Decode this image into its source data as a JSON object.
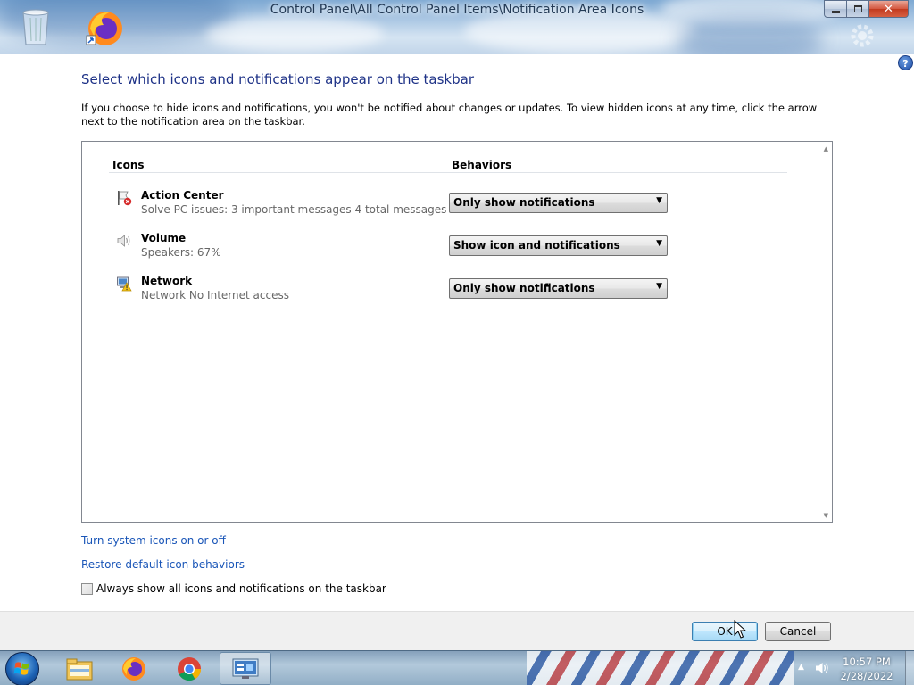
{
  "window": {
    "title": "Control Panel\\All Control Panel Items\\Notification Area Icons",
    "minimize_icon": "minimize-icon",
    "maximize_icon": "restore-icon",
    "close_icon": "close-icon"
  },
  "help": {
    "icon": "help-icon",
    "label": "?"
  },
  "page": {
    "heading": "Select which icons and notifications appear on the taskbar",
    "description": "If you choose to hide icons and notifications, you won't be notified about changes or updates. To view hidden icons at any time, click the arrow next to the notification area on the taskbar."
  },
  "icon_list": {
    "columns": {
      "icons": "Icons",
      "behaviors": "Behaviors"
    },
    "rows": [
      {
        "icon": "action-center-flag-icon",
        "name": "Action Center",
        "description": "Solve PC issues: 3 important messages  4 total messages",
        "behavior": "Only show notifications"
      },
      {
        "icon": "speaker-icon",
        "name": "Volume",
        "description": "Speakers: 67%",
        "behavior": "Show icon and notifications"
      },
      {
        "icon": "network-warning-icon",
        "name": "Network",
        "description": "Network  No Internet access",
        "behavior": "Only show notifications"
      }
    ]
  },
  "links": {
    "system_icons": "Turn system icons on or off",
    "restore_defaults": "Restore default icon behaviors"
  },
  "checkbox": {
    "label": "Always show all icons and notifications on the taskbar",
    "checked": false
  },
  "buttons": {
    "ok": "OK",
    "cancel": "Cancel"
  },
  "taskbar": {
    "items": [
      "windows-start-orb-icon",
      "file-explorer-icon",
      "firefox-icon",
      "chrome-icon",
      "control-panel-icon"
    ],
    "clock_time": "10:57 PM",
    "clock_date": "2/28/2022",
    "tray_arrow": "▲"
  },
  "colors": {
    "heading": "#1e3287",
    "link": "#1a56b8",
    "ok_accent": "#3c7fb1"
  }
}
